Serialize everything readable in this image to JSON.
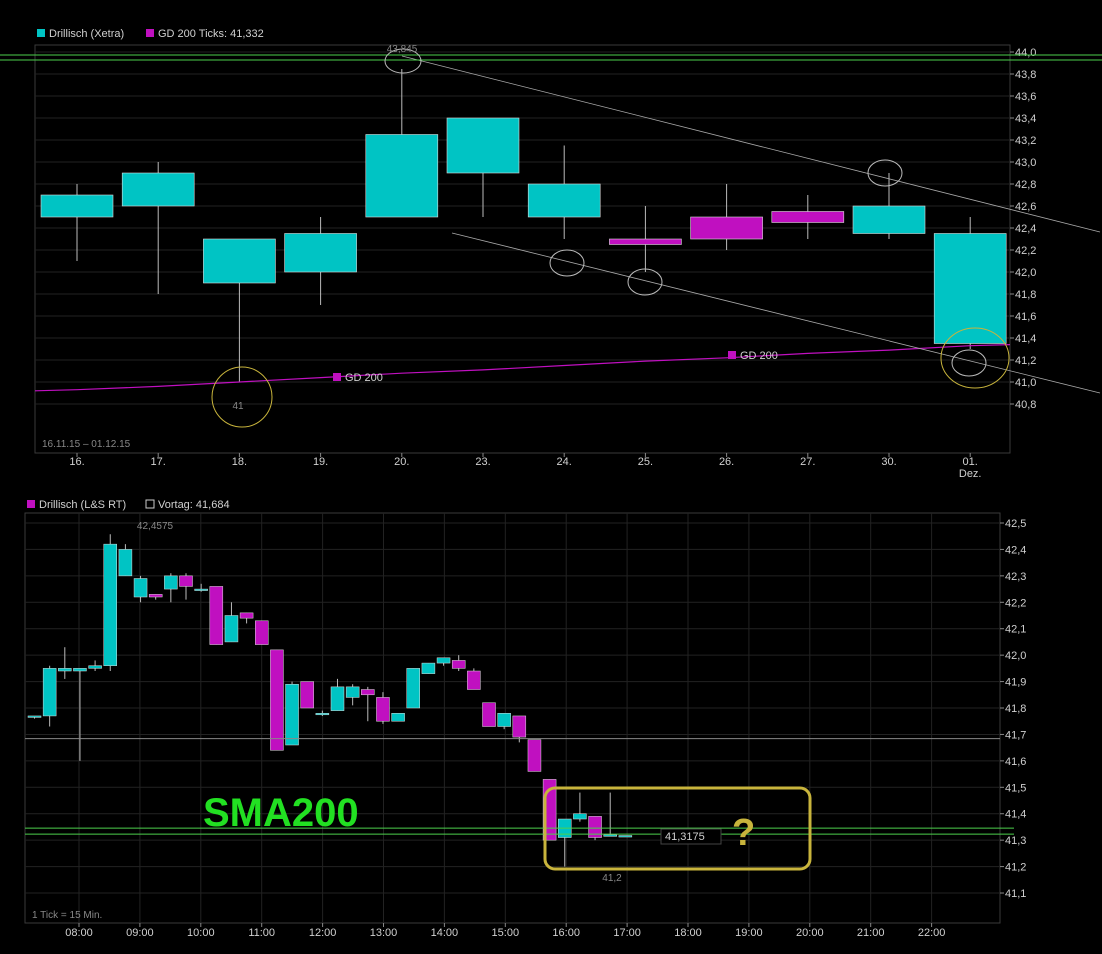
{
  "colors": {
    "up": "#00c4c4",
    "down": "#c010c0",
    "ma": "#c010c0",
    "hline": "#4cd04c",
    "grid": "#222222",
    "annot": "#c8b43c",
    "sma_text": "#22e022"
  },
  "top": {
    "legend_1": "Drillisch (Xetra)",
    "legend_2": "GD 200 Ticks: 41,332",
    "range_label": "16.11.15 – 01.12.15",
    "ma_label_1": "GD 200",
    "ma_label_2": "GD 200",
    "high_label": "43,845",
    "low_label": "41",
    "yticks": [
      "44,0",
      "43,8",
      "43,6",
      "43,4",
      "43,2",
      "43,0",
      "42,8",
      "42,6",
      "42,4",
      "42,2",
      "42,0",
      "41,8",
      "41,6",
      "41,4",
      "41,2",
      "41,0",
      "40,8"
    ],
    "xticks": [
      "16.",
      "17.",
      "18.",
      "19.",
      "20.",
      "23.",
      "24.",
      "25.",
      "26.",
      "27.",
      "30.",
      "01."
    ],
    "xtick_sub": "Dez."
  },
  "bottom": {
    "legend_1": "Drillisch (L&S RT)",
    "legend_2": "Vortag: 41,684",
    "tick_note": "1 Tick = 15 Min.",
    "high_label": "42,4575",
    "low_label": "41,2",
    "last_label": "41,3175",
    "sma_text": "SMA200",
    "question": "?",
    "yticks": [
      "42,5",
      "42,4",
      "42,3",
      "42,2",
      "42,1",
      "42,0",
      "41,9",
      "41,8",
      "41,7",
      "41,6",
      "41,5",
      "41,4",
      "41,3",
      "41,2",
      "41,1"
    ],
    "xticks": [
      "08:00",
      "09:00",
      "10:00",
      "11:00",
      "12:00",
      "13:00",
      "14:00",
      "15:00",
      "16:00",
      "17:00",
      "18:00",
      "19:00",
      "20:00",
      "21:00",
      "22:00"
    ]
  },
  "chart_data": [
    {
      "type": "candlestick",
      "title": "Drillisch (Xetra)",
      "categories": [
        "16.",
        "17.",
        "18.",
        "19.",
        "20.",
        "23.",
        "24.",
        "25.",
        "26.",
        "27.",
        "30.",
        "01."
      ],
      "series": [
        {
          "name": "Drillisch (Xetra)",
          "ohlc": [
            [
              42.5,
              42.8,
              42.1,
              42.7
            ],
            [
              42.6,
              43.0,
              41.8,
              42.9
            ],
            [
              41.9,
              42.3,
              41.0,
              42.3
            ],
            [
              42.0,
              42.5,
              41.7,
              42.35
            ],
            [
              42.5,
              43.845,
              42.5,
              43.25
            ],
            [
              42.9,
              43.4,
              42.5,
              43.4
            ],
            [
              42.5,
              43.15,
              42.3,
              42.8
            ],
            [
              42.3,
              42.6,
              42.0,
              42.25
            ],
            [
              42.5,
              42.8,
              42.2,
              42.3
            ],
            [
              42.55,
              42.7,
              42.3,
              42.45
            ],
            [
              42.35,
              42.9,
              42.3,
              42.6
            ],
            [
              41.35,
              42.5,
              41.3,
              42.35
            ]
          ]
        },
        {
          "name": "GD 200",
          "values": [
            40.93,
            40.96,
            41.0,
            41.04,
            41.08,
            41.11,
            41.15,
            41.19,
            41.22,
            41.26,
            41.29,
            41.33
          ]
        }
      ],
      "ylim": [
        40.7,
        44.05
      ]
    },
    {
      "type": "candlestick",
      "title": "Drillisch (L&S RT)",
      "x": [
        "07:45",
        "08:00",
        "08:15",
        "08:30",
        "08:45",
        "09:00",
        "09:15",
        "09:30",
        "09:45",
        "10:00",
        "10:15",
        "10:30",
        "10:45",
        "11:00",
        "11:15",
        "11:30",
        "11:45",
        "12:00",
        "12:15",
        "12:30",
        "12:45",
        "13:00",
        "13:15",
        "13:30",
        "13:45",
        "14:00",
        "14:15",
        "14:30",
        "14:45",
        "15:00",
        "15:15",
        "15:30",
        "15:45",
        "16:00",
        "16:15",
        "16:30",
        "16:45",
        "17:00",
        "17:15",
        "17:30"
      ],
      "series": [
        {
          "name": "Drillisch (L&S RT)",
          "ohlc": [
            [
              41.77,
              41.77,
              41.76,
              41.77
            ],
            [
              41.77,
              41.96,
              41.73,
              41.95
            ],
            [
              41.94,
              42.03,
              41.91,
              41.95
            ],
            [
              41.94,
              41.95,
              41.6,
              41.95
            ],
            [
              41.95,
              41.98,
              41.94,
              41.96
            ],
            [
              41.96,
              42.4575,
              41.94,
              42.42
            ],
            [
              42.3,
              42.42,
              42.3,
              42.4
            ],
            [
              42.22,
              42.3,
              42.2,
              42.29
            ],
            [
              42.23,
              42.23,
              42.21,
              42.22
            ],
            [
              42.25,
              42.31,
              42.2,
              42.3
            ],
            [
              42.3,
              42.31,
              42.21,
              42.26
            ],
            [
              42.25,
              42.27,
              42.24,
              42.25
            ],
            [
              42.26,
              42.25,
              42.04,
              42.04
            ],
            [
              42.05,
              42.2,
              42.05,
              42.15
            ],
            [
              42.16,
              42.16,
              42.12,
              42.14
            ],
            [
              42.13,
              42.13,
              42.04,
              42.04
            ],
            [
              42.02,
              42.02,
              41.64,
              41.64
            ],
            [
              41.66,
              41.9,
              41.66,
              41.89
            ],
            [
              41.9,
              41.9,
              41.8,
              41.8
            ],
            [
              41.78,
              41.79,
              41.77,
              41.78
            ],
            [
              41.79,
              41.91,
              41.79,
              41.88
            ],
            [
              41.84,
              41.89,
              41.81,
              41.88
            ],
            [
              41.87,
              41.88,
              41.75,
              41.85
            ],
            [
              41.84,
              41.86,
              41.74,
              41.75
            ],
            [
              41.75,
              41.78,
              41.78,
              41.78
            ],
            [
              41.8,
              41.95,
              41.8,
              41.95
            ],
            [
              41.93,
              41.97,
              41.93,
              41.97
            ],
            [
              41.97,
              41.99,
              41.96,
              41.99
            ],
            [
              41.98,
              42.0,
              41.94,
              41.95
            ],
            [
              41.94,
              41.95,
              41.87,
              41.87
            ],
            [
              41.82,
              41.82,
              41.73,
              41.73
            ],
            [
              41.73,
              41.78,
              41.72,
              41.78
            ],
            [
              41.77,
              41.77,
              41.67,
              41.69
            ],
            [
              41.68,
              41.68,
              41.56,
              41.56
            ],
            [
              41.53,
              41.53,
              41.3,
              41.3
            ],
            [
              41.31,
              41.37,
              41.2,
              41.38
            ],
            [
              41.38,
              41.48,
              41.37,
              41.4
            ],
            [
              41.39,
              41.39,
              41.3,
              41.31
            ],
            [
              41.32,
              41.48,
              41.32,
              41.32
            ],
            [
              41.3175,
              41.3175,
              41.3175,
              41.3175
            ]
          ]
        }
      ],
      "vortag": 41.684,
      "sma200": 41.334,
      "ylim": [
        41.02,
        42.55
      ]
    }
  ]
}
